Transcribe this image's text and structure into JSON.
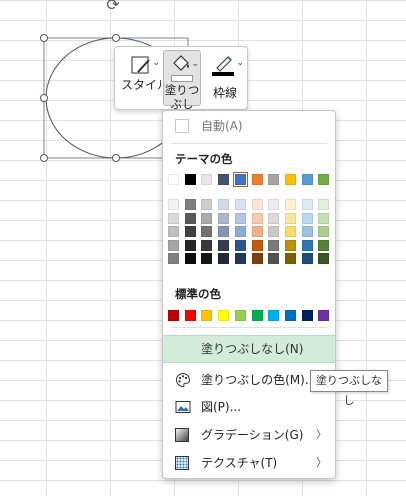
{
  "minibar": {
    "style_label": "スタイル",
    "fill_label": "塗りつぶし",
    "outline_label": "枠線",
    "outline_color": "#000000",
    "fill_color": "#ffffff"
  },
  "menu": {
    "auto_label": "自動(A)",
    "theme_title": "テーマの色",
    "theme_colors": [
      "#ffffff",
      "#000000",
      "#e7e6e6",
      "#44546a",
      "#4472c4",
      "#ed7d31",
      "#a5a5a5",
      "#ffc000",
      "#5b9bd5",
      "#70ad47"
    ],
    "theme_selected_index": 4,
    "theme_shades": [
      [
        "#f2f2f2",
        "#d9d9d9",
        "#bfbfbf",
        "#a6a6a6",
        "#808080"
      ],
      [
        "#7f7f7f",
        "#595959",
        "#404040",
        "#262626",
        "#0d0d0d"
      ],
      [
        "#d0cece",
        "#aeaaaa",
        "#757171",
        "#3a3838",
        "#171616"
      ],
      [
        "#d6dce4",
        "#adb9ca",
        "#8497b0",
        "#333f4f",
        "#222a35"
      ],
      [
        "#d9e2f3",
        "#b4c6e7",
        "#8eaadb",
        "#2f5496",
        "#1f3864"
      ],
      [
        "#fbe5d5",
        "#f7cbac",
        "#f4b083",
        "#c55a11",
        "#833c0b"
      ],
      [
        "#ededed",
        "#dbdbdb",
        "#c9c9c9",
        "#7b7b7b",
        "#525252"
      ],
      [
        "#fff2cc",
        "#fee599",
        "#ffd965",
        "#bf9000",
        "#7f6000"
      ],
      [
        "#deebf6",
        "#bdd7ee",
        "#9cc3e5",
        "#2e75b5",
        "#1e4e79"
      ],
      [
        "#e2efd9",
        "#c5e0b3",
        "#a8d08d",
        "#538135",
        "#375623"
      ]
    ],
    "standard_title": "標準の色",
    "standard_colors": [
      "#c00000",
      "#ff0000",
      "#ffc000",
      "#ffff00",
      "#92d050",
      "#00b050",
      "#00b0f0",
      "#0070c0",
      "#002060",
      "#7030a0"
    ],
    "no_fill_label": "塗りつぶしなし(N)",
    "more_colors_label": "塗りつぶしの色(M)...",
    "picture_label": "図(P)...",
    "gradient_label": "グラデーション(G)",
    "texture_label": "テクスチャ(T)"
  },
  "tooltip": "塗りつぶしなし"
}
